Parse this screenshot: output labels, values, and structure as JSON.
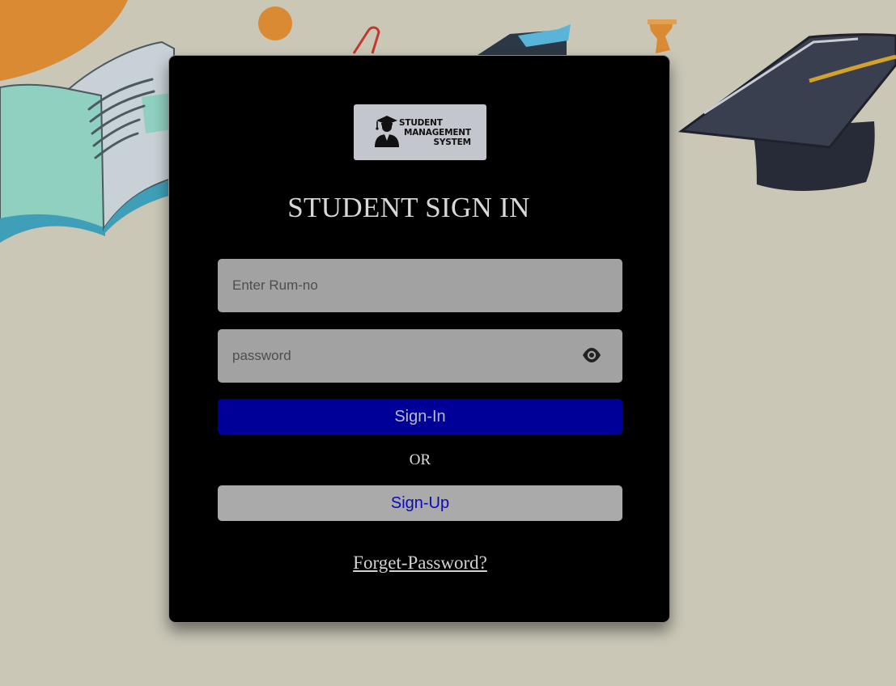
{
  "logo": {
    "icon": "graduate-icon",
    "lines": [
      "STUDENT",
      "MANAGEMENT",
      "SYSTEM"
    ]
  },
  "form": {
    "title": "STUDENT SIGN IN",
    "rum_placeholder": "Enter Rum-no",
    "rum_value": "",
    "password_placeholder": "password",
    "password_value": "",
    "password_toggle_icon": "eye-icon",
    "signin_label": "Sign-In",
    "or_label": "OR",
    "signup_label": "Sign-Up",
    "forget_label": "Forget-Password?"
  },
  "colors": {
    "page_background": "#cac7b7",
    "card_background": "#000000",
    "signin_button": "#000099",
    "signup_button": "#aaaaaa",
    "signup_text": "#0a0ab8",
    "input_background": "#a2a2a2",
    "logo_background": "#c3c6cc"
  }
}
